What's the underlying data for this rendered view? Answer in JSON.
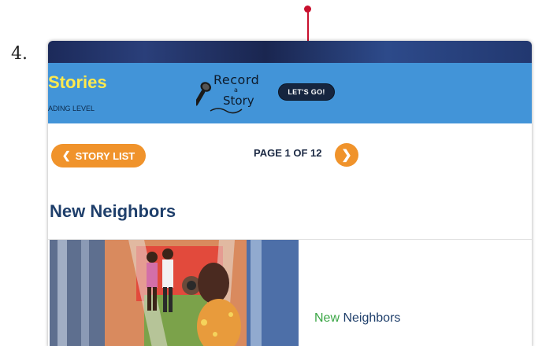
{
  "step": {
    "number": "4."
  },
  "colors": {
    "annotation_arrow": "#c8102e",
    "header_bg": "#4294d8",
    "title_yellow": "#ffe94d",
    "orange_accent": "#f0932b",
    "navy_text": "#1f3f6b",
    "green_text": "#3aa645"
  },
  "header": {
    "site_title": "Stories",
    "reading_level": "ADING LEVEL",
    "logo": {
      "line1": "Record",
      "line2": "a",
      "line3": "Story",
      "icon": "microphone-icon"
    },
    "lets_go_label": "LET'S GO!"
  },
  "pagination": {
    "back_label": "STORY LIST",
    "back_icon": "chevron-left-icon",
    "page_text": "PAGE 1 OF 12",
    "next_icon": "chevron-right-icon"
  },
  "story": {
    "title": "New Neighbors",
    "card_title_part1": "New",
    "card_title_part2": "Neighbors"
  }
}
